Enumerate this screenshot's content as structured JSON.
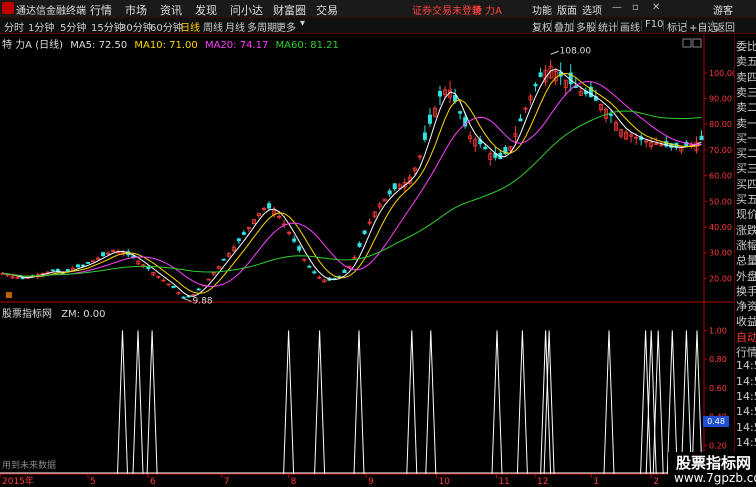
{
  "topbar": {
    "app_name": "通达信金融终端",
    "menus": [
      "行情",
      "市场",
      "资讯",
      "发现",
      "问小达",
      "财富圈",
      "交易"
    ],
    "warning": "证券交易未登录",
    "stock": "特 力A",
    "right_menus": [
      "功能",
      "版面",
      "选项"
    ],
    "user": "游客"
  },
  "periodbar": {
    "periods": [
      "分时",
      "1分钟",
      "5分钟",
      "15分钟",
      "30分钟",
      "60分钟",
      "日线",
      "周线",
      "月线",
      "多周期",
      "更多"
    ],
    "active": "日线",
    "tools": [
      "复权",
      "叠加",
      "多股",
      "统计",
      "画线",
      "F10",
      "标记",
      "+自选",
      "返回"
    ]
  },
  "infoline": {
    "stock_label": "特 力A (日线)",
    "ma5": "MA5: 72.50",
    "ma10": "MA10: 71.00",
    "ma20": "MA20: 74.17",
    "ma60": "MA60: 81.21"
  },
  "indicator": {
    "label": "股票指标网",
    "zm": "ZM: 0.00",
    "value_badge": "0.48",
    "footer_text": "用到未来数据"
  },
  "side_panel": {
    "items": [
      "委比",
      "卖五",
      "卖四",
      "卖三",
      "卖二",
      "卖一",
      "买一",
      "买二",
      "买三",
      "买四",
      "买五",
      "现价",
      "涨跌",
      "涨幅",
      "总量",
      "外盘",
      "换手",
      "净资",
      "收益",
      "自动",
      "行情",
      "14:5",
      "14:5",
      "14:5",
      "14:5",
      "14:5",
      "14:5",
      "14:5",
      "14:5"
    ]
  },
  "watermark": {
    "line1": "股票指标网",
    "line2": "www.7gpzb.com"
  },
  "colors": {
    "up": "#ff3b3b",
    "down": "#33e0e0",
    "ma5": "#ffffff",
    "ma10": "#ffd700",
    "ma20": "#ff40ff",
    "ma60": "#30d030",
    "indicator": "#ffffff",
    "axis_red": "#b00000"
  },
  "chart_data": [
    {
      "type": "candlestick",
      "title": "特 力A (日线)",
      "y_axis_ticks": [
        20.0,
        30.0,
        40.0,
        50.0,
        60.0,
        70.0,
        80.0,
        90.0,
        100.0
      ],
      "ylim": [
        12,
        112
      ],
      "x_axis_labels": [
        "2015年",
        "5",
        "6",
        "7",
        "8",
        "9",
        "10",
        "11",
        "12",
        "1",
        "2"
      ],
      "annotations": [
        {
          "label": "108.00",
          "value": 108.0
        },
        {
          "label": "9.88",
          "value": 9.88
        }
      ],
      "series": [
        {
          "name": "MA5",
          "value": 72.5
        },
        {
          "name": "MA10",
          "value": 71.0
        },
        {
          "name": "MA20",
          "value": 74.17
        },
        {
          "name": "MA60",
          "value": 81.21
        }
      ],
      "close_path": [
        22,
        21,
        20,
        21,
        22,
        23,
        22,
        24,
        25,
        27,
        29,
        31,
        30,
        28,
        25,
        22,
        19,
        16,
        12,
        14,
        18,
        23,
        28,
        33,
        38,
        44,
        48,
        46,
        40,
        33,
        26,
        21,
        19,
        20,
        23,
        30,
        40,
        48,
        52,
        56,
        58,
        65,
        78,
        90,
        95,
        86,
        76,
        73,
        69,
        66,
        70,
        80,
        90,
        98,
        103,
        99,
        96,
        93,
        91,
        88,
        84,
        78,
        76,
        74,
        73,
        72,
        71,
        71,
        72,
        74
      ]
    },
    {
      "type": "line",
      "title": "股票指标网",
      "y_axis_ticks": [
        0.2,
        0.4,
        0.6,
        0.8,
        1.0
      ],
      "ylim": [
        0,
        1.1
      ],
      "spike_x_fractions": [
        0.174,
        0.196,
        0.216,
        0.41,
        0.454,
        0.51,
        0.585,
        0.612,
        0.706,
        0.742,
        0.775,
        0.78,
        0.865,
        0.917,
        0.925,
        0.935,
        0.955,
        0.975,
        0.99
      ]
    }
  ]
}
